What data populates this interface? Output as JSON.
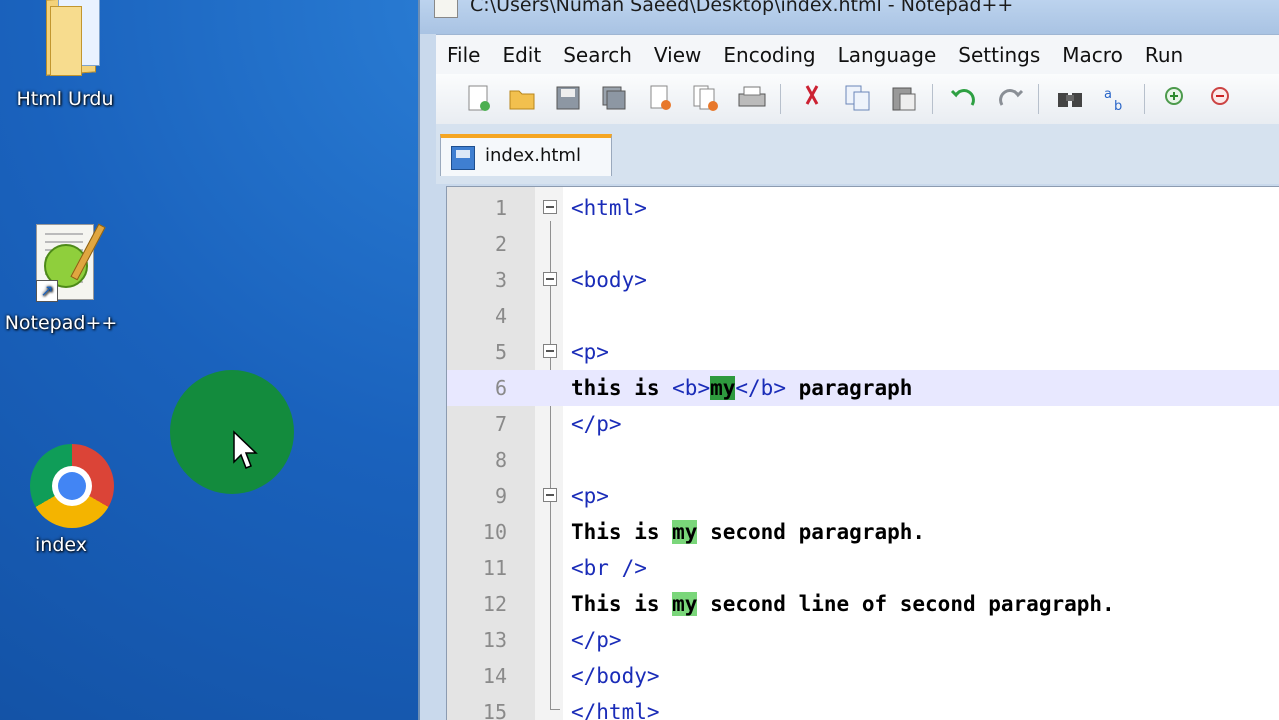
{
  "desktop": {
    "icons": [
      {
        "label": "Html Urdu",
        "icon": "folder-icon"
      },
      {
        "label": "Notepad++",
        "icon": "notepad-plus-plus-icon"
      },
      {
        "label": "index",
        "icon": "chrome-icon"
      }
    ]
  },
  "window": {
    "title": "C:\\Users\\Numan Saeed\\Desktop\\index.html - Notepad++",
    "menu": [
      "File",
      "Edit",
      "Search",
      "View",
      "Encoding",
      "Language",
      "Settings",
      "Macro",
      "Run"
    ],
    "toolbar_icons": [
      "new-file-icon",
      "open-file-icon",
      "save-icon",
      "save-all-icon",
      "close-icon",
      "close-all-icon",
      "print-icon",
      "cut-icon",
      "copy-icon",
      "paste-icon",
      "undo-icon",
      "redo-icon",
      "find-icon",
      "replace-icon",
      "zoom-in-icon",
      "zoom-out-icon"
    ],
    "tab": {
      "label": "index.html"
    }
  },
  "editor": {
    "lines": [
      {
        "n": "1",
        "text": "<html>"
      },
      {
        "n": "2",
        "text": ""
      },
      {
        "n": "3",
        "text": "<body>"
      },
      {
        "n": "4",
        "text": ""
      },
      {
        "n": "5",
        "text": "<p>"
      },
      {
        "n": "6",
        "text": "this is <b>my</b> paragraph"
      },
      {
        "n": "7",
        "text": "</p>"
      },
      {
        "n": "8",
        "text": ""
      },
      {
        "n": "9",
        "text": "<p>"
      },
      {
        "n": "10",
        "text": "This is my second paragraph."
      },
      {
        "n": "11",
        "text": "<br />"
      },
      {
        "n": "12",
        "text": "This is my second line of second paragraph."
      },
      {
        "n": "13",
        "text": "</p>"
      },
      {
        "n": "14",
        "text": "</body>"
      },
      {
        "n": "15",
        "text": "</html>"
      }
    ],
    "seg": {
      "l6_a": "this is ",
      "l6_b_open": "<b>",
      "l6_my": "my",
      "l6_b_close": "</b>",
      "l6_rest": " paragraph",
      "l10_a": "This is ",
      "l10_my": "my",
      "l10_rest": " second paragraph.",
      "l12_a": "This is ",
      "l12_my": "my",
      "l12_rest": " second line of second paragraph."
    }
  },
  "colors": {
    "tag": "#1a2cb8",
    "highlight": "#7ad67a",
    "current_line": "#e8e8ff",
    "click_indicator": "#138b3d"
  }
}
